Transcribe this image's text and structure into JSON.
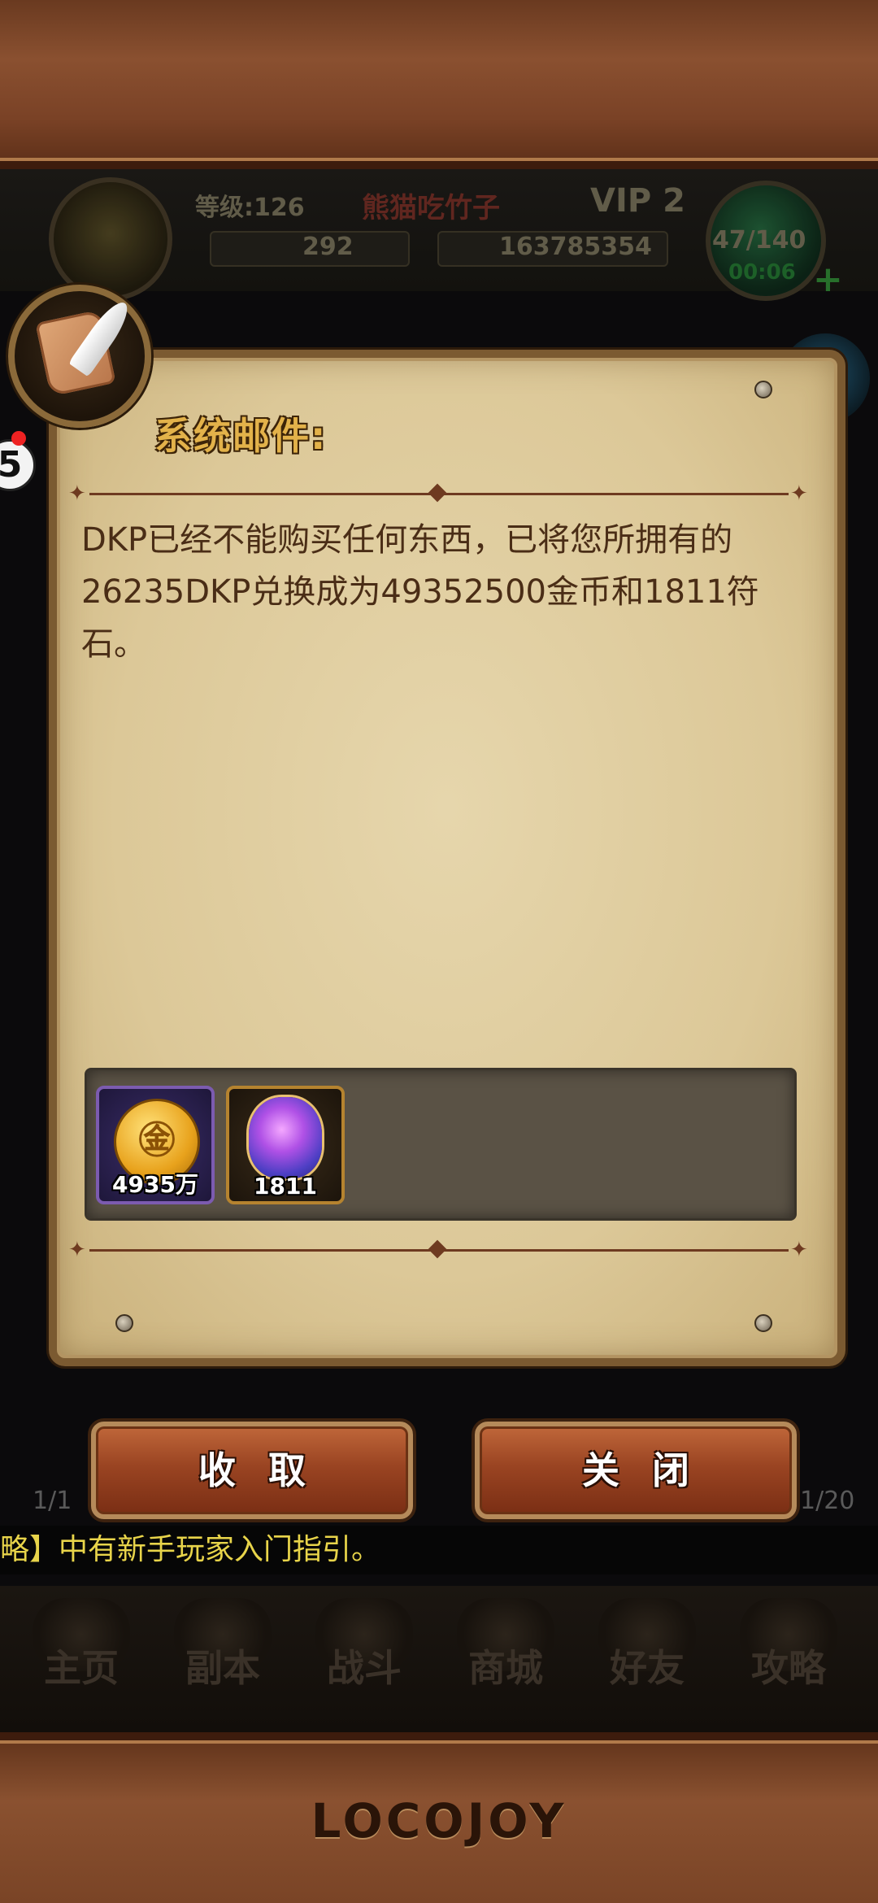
{
  "hud": {
    "level": "等级:126",
    "player_name": "熊猫吃竹子",
    "vip": "VIP 2",
    "gems": "292",
    "gold": "163785354",
    "energy": "47/140",
    "timer": "00:06"
  },
  "badge": {
    "text": "5"
  },
  "dialog": {
    "title": "系统邮件:",
    "message": "DKP已经不能购买任何东西，已将您所拥有的26235DKP兑换成为49352500金币和1811符石。",
    "attachments": [
      {
        "icon": "gold-coin-icon",
        "count": "4935万"
      },
      {
        "icon": "rune-stone-icon",
        "count": "1811"
      }
    ],
    "collect_label": "收取",
    "close_label": "关闭"
  },
  "pager": {
    "left": "1/1",
    "right": "1/20"
  },
  "ticker": {
    "text": "略】中有新手玩家入门指引。"
  },
  "nav": {
    "items": [
      {
        "label": "主页"
      },
      {
        "label": "副本"
      },
      {
        "label": "战斗"
      },
      {
        "label": "商城"
      },
      {
        "label": "好友"
      },
      {
        "label": "攻略"
      }
    ]
  },
  "footer": {
    "logo": "LOCOJOY"
  },
  "colors": {
    "title_gold": "#e3b24a",
    "ticker_yellow": "#e8d44a",
    "button_brown": "#9a4422"
  }
}
